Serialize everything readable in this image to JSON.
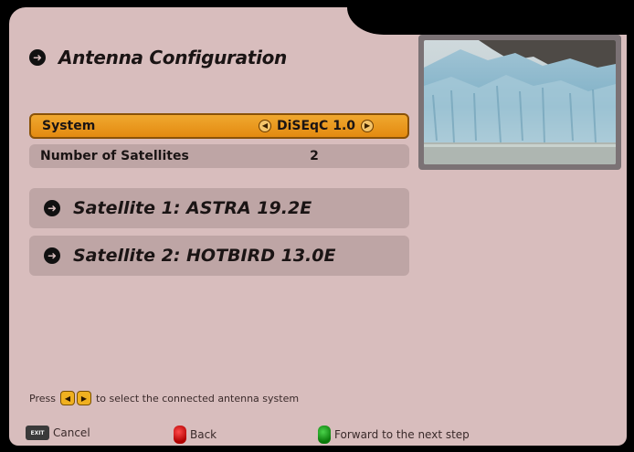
{
  "header": {
    "title": "Antenna Configuration"
  },
  "settings": {
    "system_label": "System",
    "system_value": "DiSEqC 1.0",
    "num_satellites_label": "Number of Satellites",
    "num_satellites_value": "2"
  },
  "satellites": [
    {
      "label": "Satellite 1: ASTRA 19.2E"
    },
    {
      "label": "Satellite 2: HOTBIRD 13.0E"
    }
  ],
  "hint": {
    "prefix": "Press",
    "suffix": "to select the connected antenna system"
  },
  "footer": {
    "exit_key": "EXIT",
    "cancel": "Cancel",
    "back": "Back",
    "forward": "Forward to the next step"
  },
  "colors": {
    "background": "#d8bdbd",
    "selected_row": "#e99a1e",
    "row": "#bea5a5",
    "red_button": "#d00000",
    "green_button": "#0a9a0a"
  }
}
